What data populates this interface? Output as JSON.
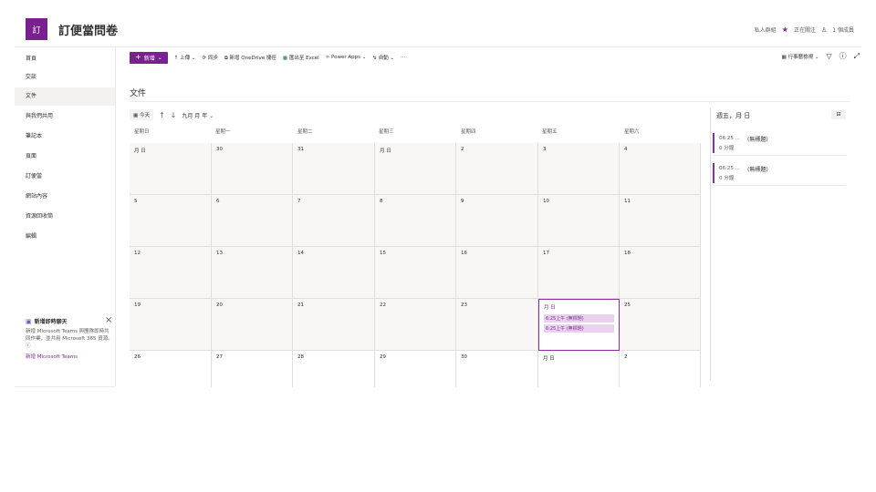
{
  "site": {
    "logo_text": "訂",
    "title": "訂便當問卷"
  },
  "header_right": {
    "privacy": "私人群組",
    "follow_icon": "star-icon",
    "follow": "正在關注",
    "members_icon": "person-icon",
    "members": "1 個成員"
  },
  "sidebar": {
    "items": [
      {
        "label": "首頁",
        "selected": false,
        "purple": true
      },
      {
        "label": "交談",
        "selected": false
      },
      {
        "label": "文件",
        "selected": true
      },
      {
        "label": "與我們共用",
        "selected": false
      },
      {
        "label": "筆記本",
        "selected": false
      },
      {
        "label": "頁面",
        "selected": false
      },
      {
        "label": "訂便當",
        "selected": false
      },
      {
        "label": "網站內容",
        "selected": false
      },
      {
        "label": "資源回收筒",
        "selected": false
      },
      {
        "label": "編輯",
        "selected": false,
        "purple": true
      }
    ],
    "teams": {
      "title": "新增即時聊天",
      "body": "新增 Microsoft Teams 與團隊即時共同作業，並共用 Microsoft 365 資源。",
      "link": "新增 Microsoft Teams"
    }
  },
  "commandbar": {
    "new": "新增",
    "upload": "上傳",
    "sync": "同步",
    "add_shortcut": "新增 OneDrive 捷徑",
    "export": "匯出至 Excel",
    "power_apps": "Power Apps",
    "automate": "自動",
    "more": "⋯",
    "view": "行事曆檢視",
    "filter_icon": "filter-icon",
    "info_icon": "info-icon",
    "expand_icon": "expand-icon"
  },
  "library_title": "文件",
  "calendar": {
    "today": "今天",
    "month_label": "九月 月 年",
    "weekdays": [
      "星期日",
      "星期一",
      "星期二",
      "星期三",
      "星期四",
      "星期五",
      "星期六"
    ],
    "weeks": [
      [
        "月 日",
        "30",
        "31",
        "月 日",
        "2",
        "3",
        "4"
      ],
      [
        "5",
        "6",
        "7",
        "8",
        "9",
        "10",
        "11"
      ],
      [
        "12",
        "13",
        "14",
        "15",
        "16",
        "17",
        "18"
      ],
      [
        "19",
        "20",
        "21",
        "22",
        "23",
        "月 日",
        "25"
      ],
      [
        "26",
        "27",
        "28",
        "29",
        "30",
        "月 日",
        "2"
      ]
    ],
    "selected_events": [
      "6:25上午 (無標題)",
      "6:25上午 (無標題)"
    ]
  },
  "panel": {
    "title": "週五，月 日",
    "events": [
      {
        "time": "06:25 ...",
        "title": "(無標題)",
        "duration": "0 分鐘"
      },
      {
        "time": "06:25 ...",
        "title": "(無標題)",
        "duration": "0 分鐘"
      }
    ]
  }
}
